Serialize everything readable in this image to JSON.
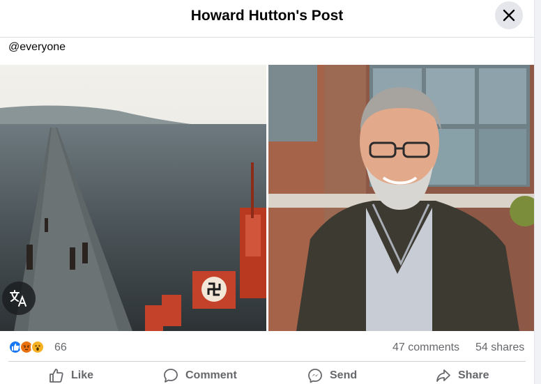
{
  "header": {
    "title": "Howard Hutton's Post",
    "close_icon": "close-icon"
  },
  "post": {
    "text": "@everyone"
  },
  "translate": {
    "icon": "translate-icon"
  },
  "stats": {
    "reaction_icons": [
      "like-reaction-icon",
      "angry-reaction-icon",
      "wow-reaction-icon"
    ],
    "reaction_count": "66",
    "comments": "47 comments",
    "shares": "54 shares"
  },
  "actions": [
    {
      "label": "Like",
      "icon": "thumbs-up-icon"
    },
    {
      "label": "Comment",
      "icon": "comment-icon"
    },
    {
      "label": "Send",
      "icon": "messenger-icon"
    },
    {
      "label": "Share",
      "icon": "share-icon"
    }
  ],
  "colors": {
    "like": "#1877f2",
    "angry": "#e9710f",
    "wow": "#f7b125",
    "muted_text": "#65676b"
  }
}
